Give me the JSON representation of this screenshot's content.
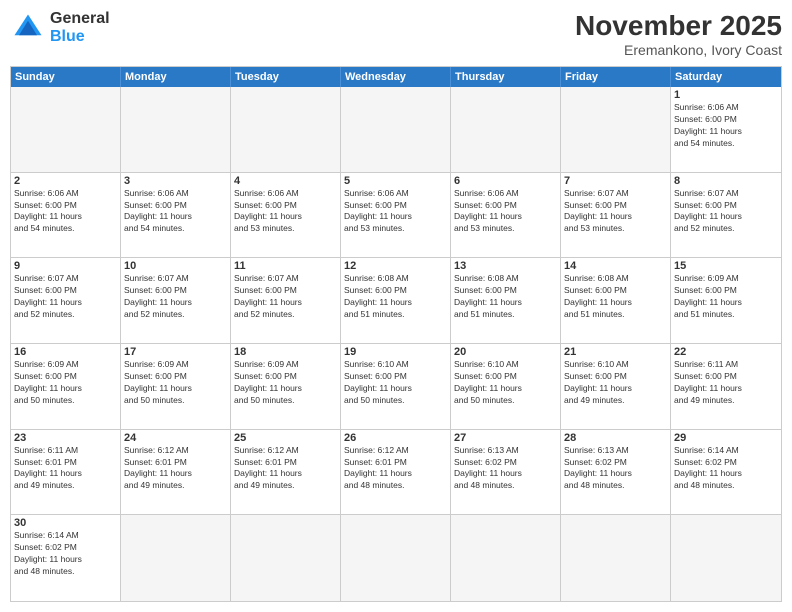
{
  "header": {
    "logo_general": "General",
    "logo_blue": "Blue",
    "month_title": "November 2025",
    "subtitle": "Eremankono, Ivory Coast"
  },
  "day_headers": [
    "Sunday",
    "Monday",
    "Tuesday",
    "Wednesday",
    "Thursday",
    "Friday",
    "Saturday"
  ],
  "weeks": [
    [
      {
        "day": "",
        "info": ""
      },
      {
        "day": "",
        "info": ""
      },
      {
        "day": "",
        "info": ""
      },
      {
        "day": "",
        "info": ""
      },
      {
        "day": "",
        "info": ""
      },
      {
        "day": "",
        "info": ""
      },
      {
        "day": "1",
        "info": "Sunrise: 6:06 AM\nSunset: 6:00 PM\nDaylight: 11 hours\nand 54 minutes."
      }
    ],
    [
      {
        "day": "2",
        "info": "Sunrise: 6:06 AM\nSunset: 6:00 PM\nDaylight: 11 hours\nand 54 minutes."
      },
      {
        "day": "3",
        "info": "Sunrise: 6:06 AM\nSunset: 6:00 PM\nDaylight: 11 hours\nand 54 minutes."
      },
      {
        "day": "4",
        "info": "Sunrise: 6:06 AM\nSunset: 6:00 PM\nDaylight: 11 hours\nand 53 minutes."
      },
      {
        "day": "5",
        "info": "Sunrise: 6:06 AM\nSunset: 6:00 PM\nDaylight: 11 hours\nand 53 minutes."
      },
      {
        "day": "6",
        "info": "Sunrise: 6:06 AM\nSunset: 6:00 PM\nDaylight: 11 hours\nand 53 minutes."
      },
      {
        "day": "7",
        "info": "Sunrise: 6:07 AM\nSunset: 6:00 PM\nDaylight: 11 hours\nand 53 minutes."
      },
      {
        "day": "8",
        "info": "Sunrise: 6:07 AM\nSunset: 6:00 PM\nDaylight: 11 hours\nand 52 minutes."
      }
    ],
    [
      {
        "day": "9",
        "info": "Sunrise: 6:07 AM\nSunset: 6:00 PM\nDaylight: 11 hours\nand 52 minutes."
      },
      {
        "day": "10",
        "info": "Sunrise: 6:07 AM\nSunset: 6:00 PM\nDaylight: 11 hours\nand 52 minutes."
      },
      {
        "day": "11",
        "info": "Sunrise: 6:07 AM\nSunset: 6:00 PM\nDaylight: 11 hours\nand 52 minutes."
      },
      {
        "day": "12",
        "info": "Sunrise: 6:08 AM\nSunset: 6:00 PM\nDaylight: 11 hours\nand 51 minutes."
      },
      {
        "day": "13",
        "info": "Sunrise: 6:08 AM\nSunset: 6:00 PM\nDaylight: 11 hours\nand 51 minutes."
      },
      {
        "day": "14",
        "info": "Sunrise: 6:08 AM\nSunset: 6:00 PM\nDaylight: 11 hours\nand 51 minutes."
      },
      {
        "day": "15",
        "info": "Sunrise: 6:09 AM\nSunset: 6:00 PM\nDaylight: 11 hours\nand 51 minutes."
      }
    ],
    [
      {
        "day": "16",
        "info": "Sunrise: 6:09 AM\nSunset: 6:00 PM\nDaylight: 11 hours\nand 50 minutes."
      },
      {
        "day": "17",
        "info": "Sunrise: 6:09 AM\nSunset: 6:00 PM\nDaylight: 11 hours\nand 50 minutes."
      },
      {
        "day": "18",
        "info": "Sunrise: 6:09 AM\nSunset: 6:00 PM\nDaylight: 11 hours\nand 50 minutes."
      },
      {
        "day": "19",
        "info": "Sunrise: 6:10 AM\nSunset: 6:00 PM\nDaylight: 11 hours\nand 50 minutes."
      },
      {
        "day": "20",
        "info": "Sunrise: 6:10 AM\nSunset: 6:00 PM\nDaylight: 11 hours\nand 50 minutes."
      },
      {
        "day": "21",
        "info": "Sunrise: 6:10 AM\nSunset: 6:00 PM\nDaylight: 11 hours\nand 49 minutes."
      },
      {
        "day": "22",
        "info": "Sunrise: 6:11 AM\nSunset: 6:00 PM\nDaylight: 11 hours\nand 49 minutes."
      }
    ],
    [
      {
        "day": "23",
        "info": "Sunrise: 6:11 AM\nSunset: 6:01 PM\nDaylight: 11 hours\nand 49 minutes."
      },
      {
        "day": "24",
        "info": "Sunrise: 6:12 AM\nSunset: 6:01 PM\nDaylight: 11 hours\nand 49 minutes."
      },
      {
        "day": "25",
        "info": "Sunrise: 6:12 AM\nSunset: 6:01 PM\nDaylight: 11 hours\nand 49 minutes."
      },
      {
        "day": "26",
        "info": "Sunrise: 6:12 AM\nSunset: 6:01 PM\nDaylight: 11 hours\nand 48 minutes."
      },
      {
        "day": "27",
        "info": "Sunrise: 6:13 AM\nSunset: 6:02 PM\nDaylight: 11 hours\nand 48 minutes."
      },
      {
        "day": "28",
        "info": "Sunrise: 6:13 AM\nSunset: 6:02 PM\nDaylight: 11 hours\nand 48 minutes."
      },
      {
        "day": "29",
        "info": "Sunrise: 6:14 AM\nSunset: 6:02 PM\nDaylight: 11 hours\nand 48 minutes."
      }
    ],
    [
      {
        "day": "30",
        "info": "Sunrise: 6:14 AM\nSunset: 6:02 PM\nDaylight: 11 hours\nand 48 minutes."
      },
      {
        "day": "",
        "info": ""
      },
      {
        "day": "",
        "info": ""
      },
      {
        "day": "",
        "info": ""
      },
      {
        "day": "",
        "info": ""
      },
      {
        "day": "",
        "info": ""
      },
      {
        "day": "",
        "info": ""
      }
    ]
  ]
}
